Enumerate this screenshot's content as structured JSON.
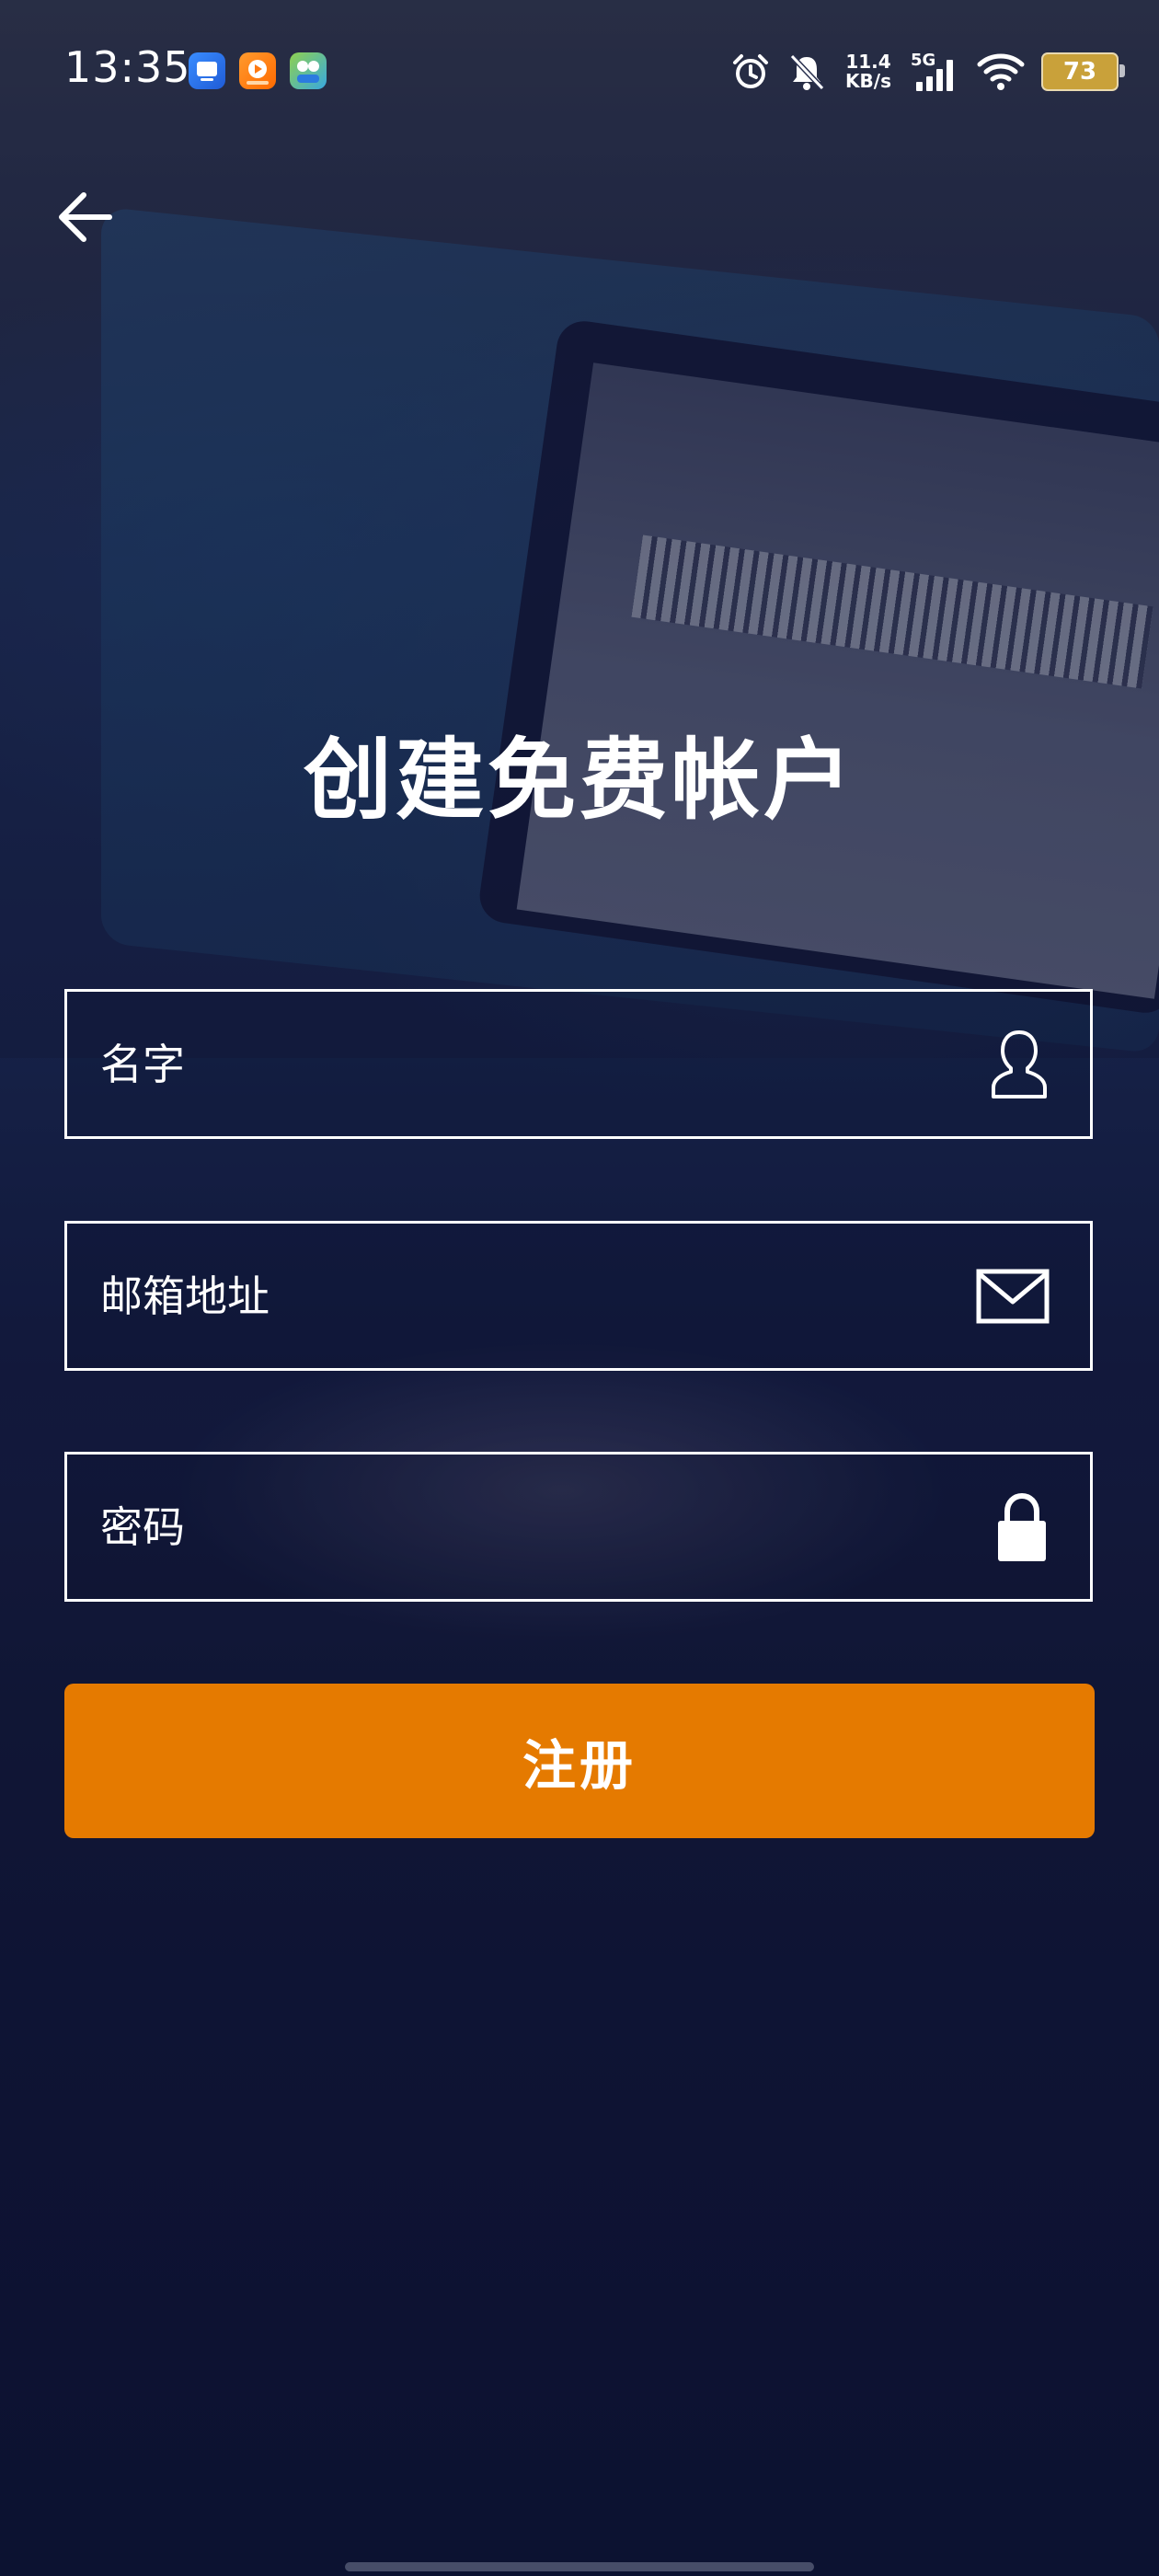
{
  "status_bar": {
    "time": "13:35",
    "net_speed_value": "11.4",
    "net_speed_unit": "KB/s",
    "network_type": "5G",
    "battery_level": "73",
    "app_icons": [
      "blue-app-icon",
      "video-app-icon",
      "game-app-icon"
    ],
    "status_icons": [
      "alarm-icon",
      "mute-bell-icon",
      "signal-icon",
      "wifi-icon",
      "battery-icon"
    ]
  },
  "header": {
    "back_icon": "arrow-left-icon"
  },
  "page": {
    "title": "创建免费帐户"
  },
  "form": {
    "name_placeholder": "名字",
    "name_icon": "person-icon",
    "email_placeholder": "邮箱地址",
    "email_icon": "envelope-icon",
    "password_placeholder": "密码",
    "password_icon": "lock-icon",
    "register_label": "注册"
  },
  "colors": {
    "accent": "#e57a00",
    "text": "#ffffff",
    "background": "#151a3a"
  }
}
